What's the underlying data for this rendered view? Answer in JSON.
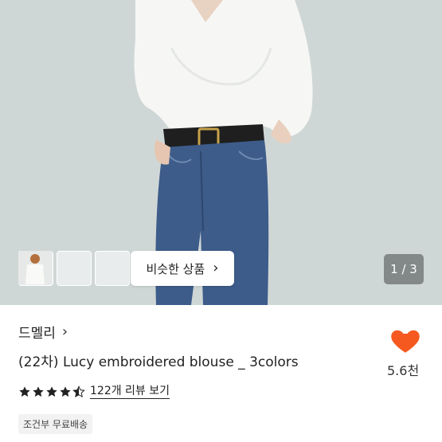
{
  "gallery": {
    "similar_label": "비슷한 상품",
    "counter": "1 / 3"
  },
  "product": {
    "shop_name": "드멜리",
    "title": "(22차) Lucy embroidered blouse _ 3colors",
    "rating": 4.5,
    "rating_max": 5,
    "review_link": "122개 리뷰 보기",
    "shipping_badge": "조건부 무료배송"
  },
  "like": {
    "count": "5.6천",
    "color": "#f5591f"
  },
  "colors": {
    "star": "#222222",
    "background": "#ffffff"
  }
}
